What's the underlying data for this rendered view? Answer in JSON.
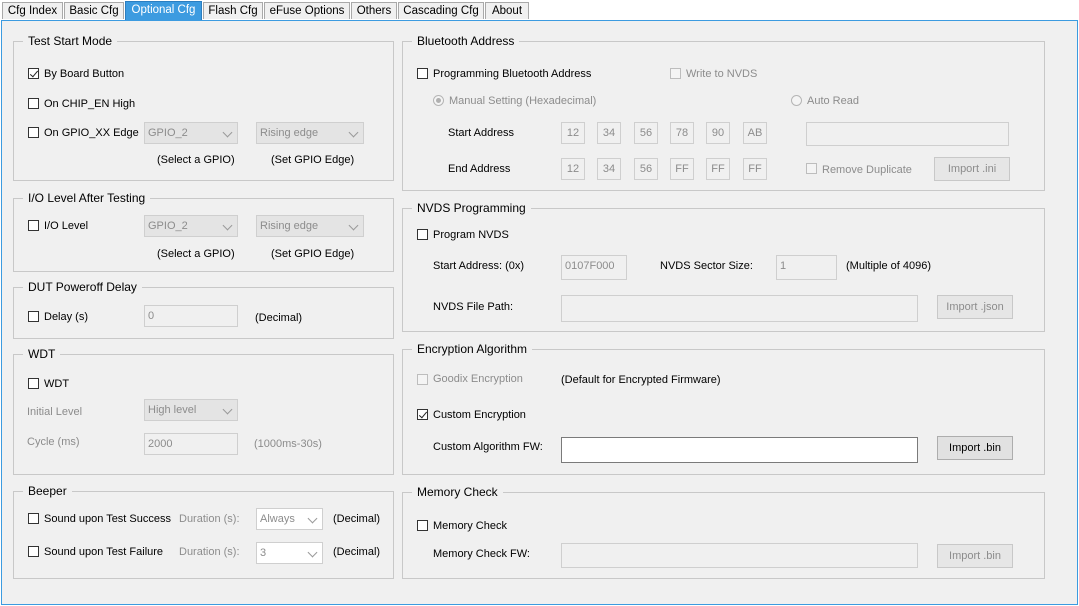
{
  "tabs": [
    {
      "label": "Cfg Index"
    },
    {
      "label": "Basic Cfg"
    },
    {
      "label": "Optional Cfg"
    },
    {
      "label": "Flash Cfg"
    },
    {
      "label": "eFuse Options"
    },
    {
      "label": "Others"
    },
    {
      "label": "Cascading Cfg"
    },
    {
      "label": "About"
    }
  ],
  "test_start_mode": {
    "title": "Test Start Mode",
    "by_board_button": "By Board Button",
    "on_chip_en_high": "On CHIP_EN High",
    "on_gpio_edge": "On GPIO_XX Edge",
    "gpio_value": "GPIO_2",
    "edge_value": "Rising edge",
    "select_gpio_hint": "(Select a GPIO)",
    "set_edge_hint": "(Set GPIO Edge)"
  },
  "io_level": {
    "title": "I/O Level After Testing",
    "io_level_label": "I/O Level",
    "gpio_value": "GPIO_2",
    "edge_value": "Rising edge",
    "select_gpio_hint": "(Select a GPIO)",
    "set_edge_hint": "(Set GPIO Edge)"
  },
  "dut_poweroff": {
    "title": "DUT Poweroff Delay",
    "delay_label": "Delay (s)",
    "delay_value": "0",
    "unit": "(Decimal)"
  },
  "wdt": {
    "title": "WDT",
    "wdt_label": "WDT",
    "initial_level_label": "Initial Level",
    "initial_level_value": "High level",
    "cycle_label": "Cycle (ms)",
    "cycle_value": "2000",
    "cycle_hint": "(1000ms-30s)"
  },
  "beeper": {
    "title": "Beeper",
    "success_label": "Sound upon Test Success",
    "failure_label": "Sound upon Test Failure",
    "duration_label": "Duration (s):",
    "success_duration": "Always",
    "failure_duration": "3",
    "unit": "(Decimal)"
  },
  "bluetooth": {
    "title": "Bluetooth Address",
    "program_label": "Programming Bluetooth Address",
    "write_nvds_label": "Write to NVDS",
    "manual_label": "Manual Setting (Hexadecimal)",
    "auto_read_label": "Auto Read",
    "start_address_label": "Start Address",
    "end_address_label": "End Address",
    "start_bytes": [
      "12",
      "34",
      "56",
      "78",
      "90",
      "AB"
    ],
    "end_bytes": [
      "12",
      "34",
      "56",
      "FF",
      "FF",
      "FF"
    ],
    "remove_duplicate_label": "Remove Duplicate",
    "import_label": "Import .ini"
  },
  "nvds": {
    "title": "NVDS Programming",
    "program_label": "Program NVDS",
    "start_address_label": "Start Address: (0x)",
    "start_address_value": "0107F000",
    "sector_size_label": "NVDS Sector Size:",
    "sector_size_value": "1",
    "sector_hint": "(Multiple of 4096)",
    "file_path_label": "NVDS File Path:",
    "import_label": "Import .json"
  },
  "encryption": {
    "title": "Encryption Algorithm",
    "goodix_label": "Goodix Encryption",
    "goodix_hint": "(Default for Encrypted Firmware)",
    "custom_label": "Custom Encryption",
    "custom_fw_label": "Custom Algorithm FW:",
    "import_label": "Import .bin"
  },
  "memory_check": {
    "title": "Memory Check",
    "check_label": "Memory Check",
    "fw_label": "Memory Check FW:",
    "import_label": "Import .bin"
  },
  "colors": {
    "active_tab": "#3c9be0",
    "pane_border": "#3c9be0",
    "background": "#f0f0f0"
  }
}
